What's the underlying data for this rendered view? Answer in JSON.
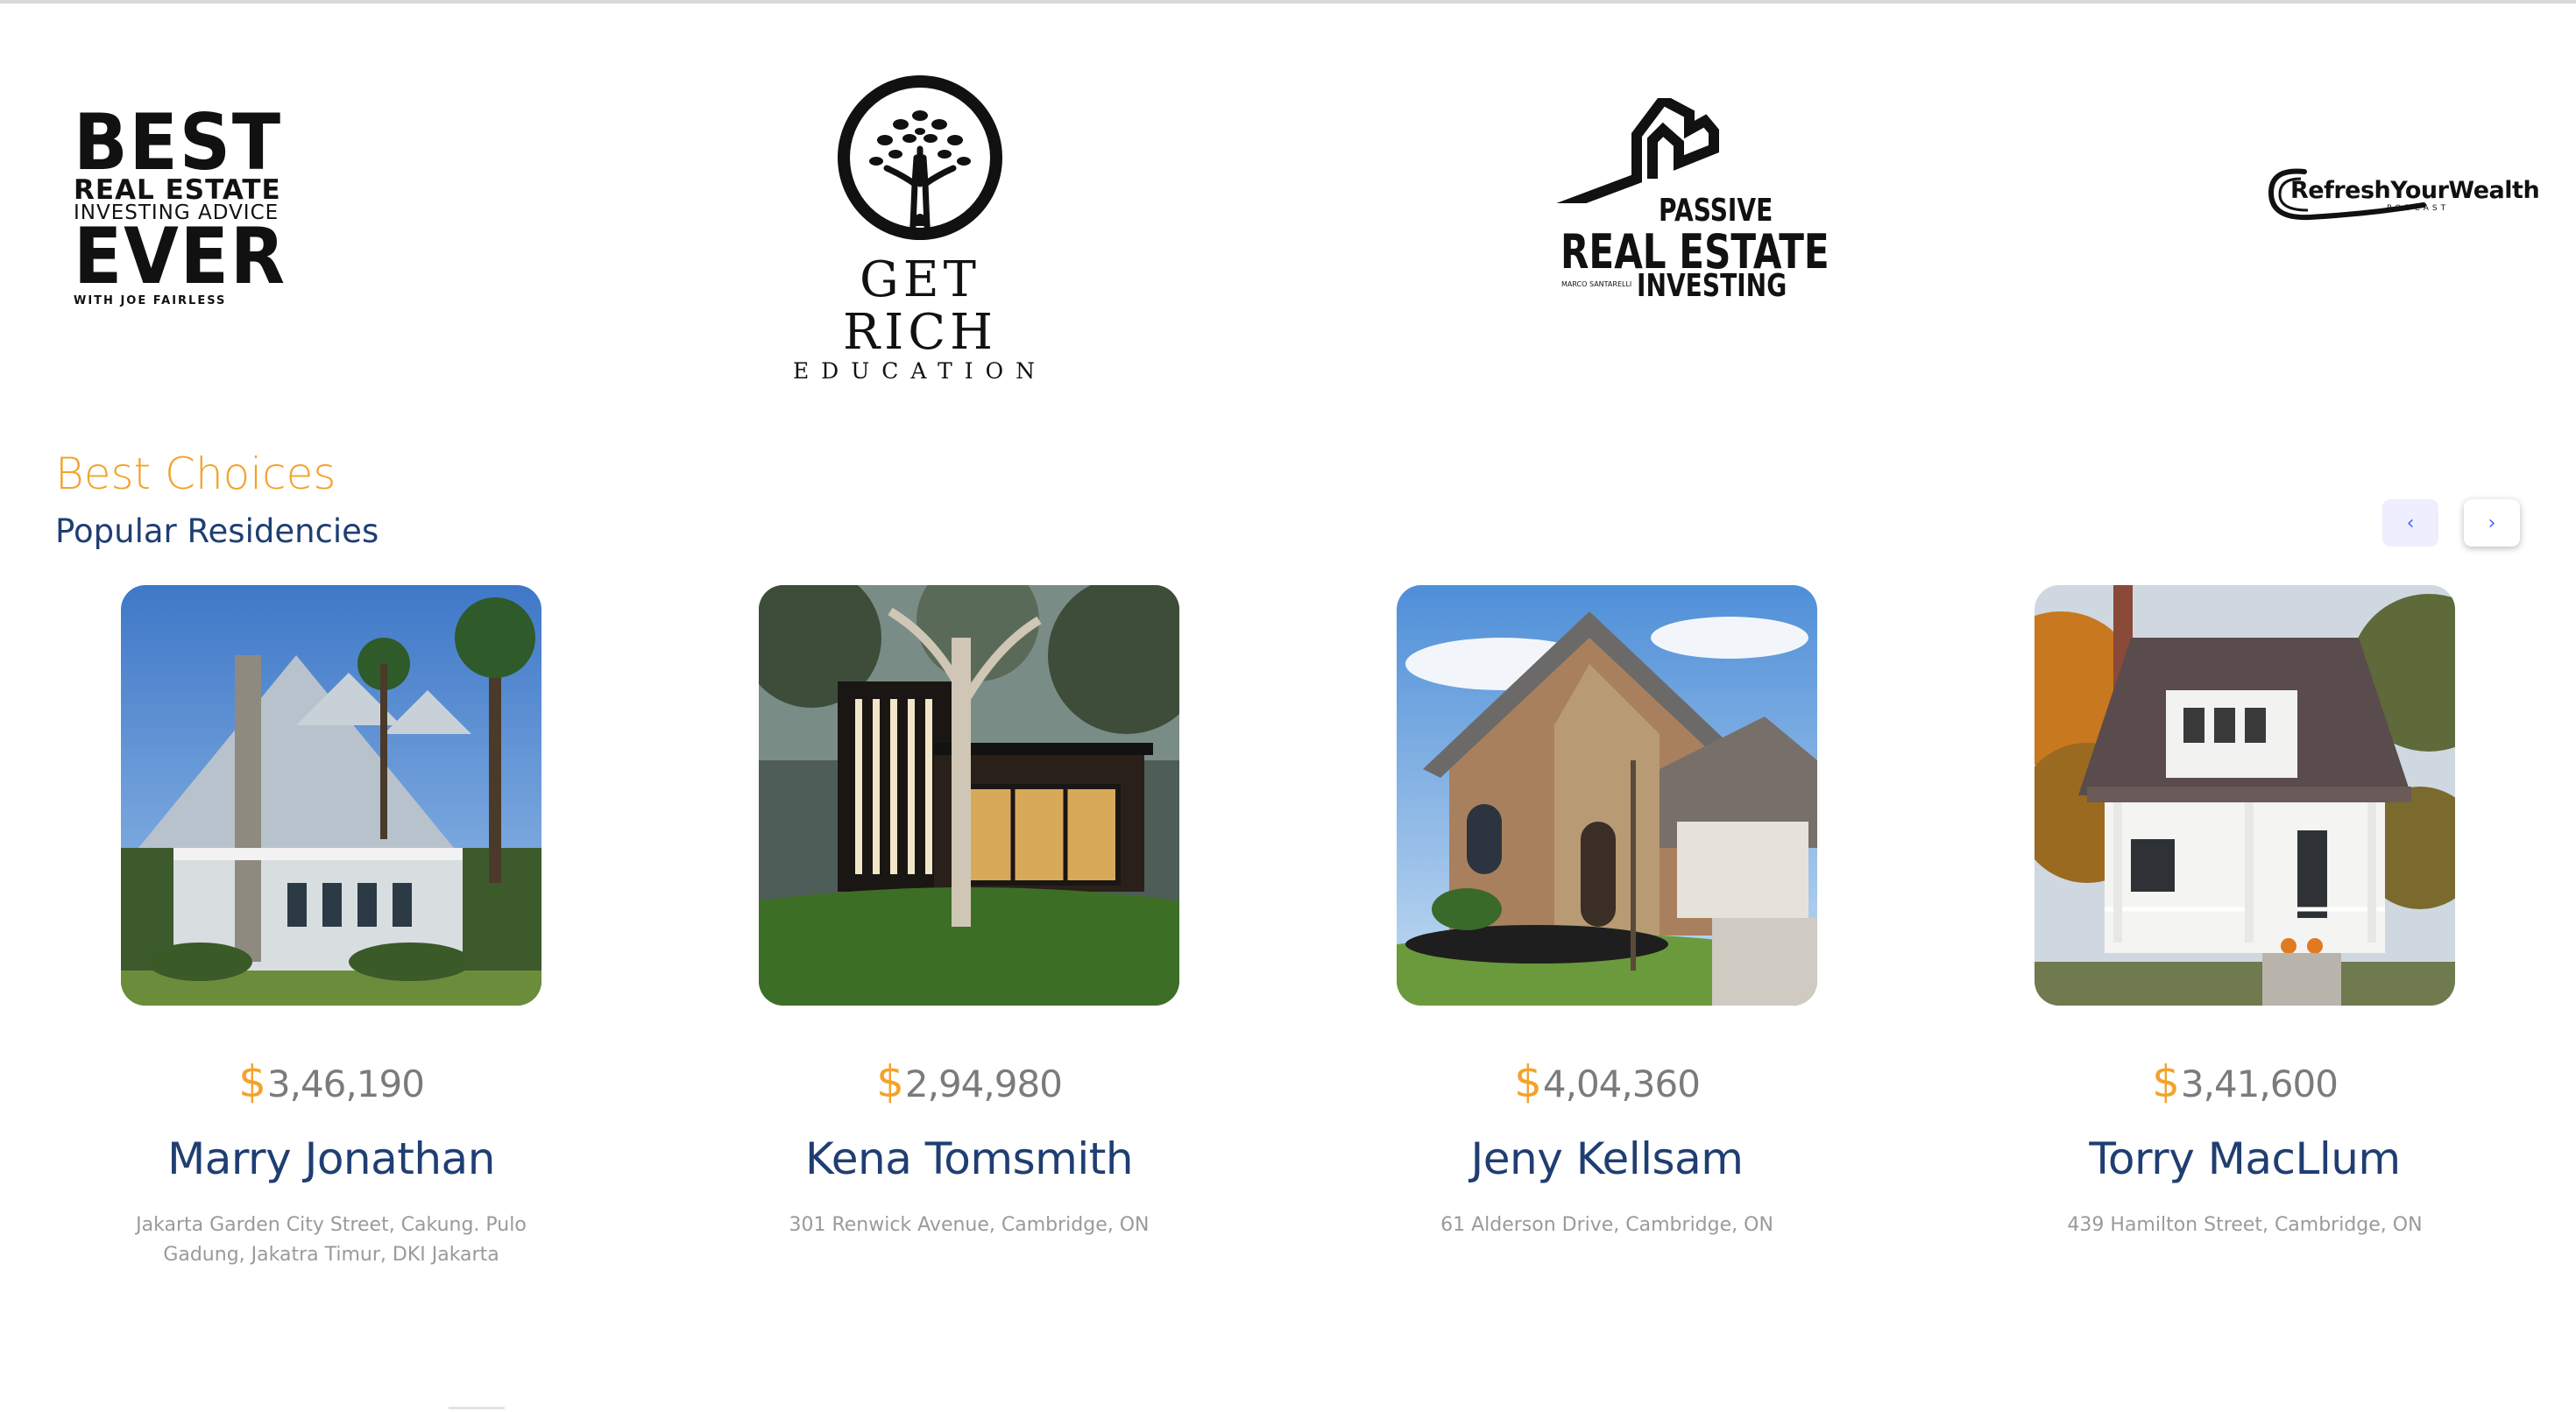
{
  "logos": {
    "best_ever": {
      "line1": "BEST",
      "line2": "REAL ESTATE",
      "line3": "INVESTING ADVICE",
      "line4": "EVER",
      "line5": "WITH JOE FAIRLESS"
    },
    "get_rich": {
      "line1": "GET RICH",
      "line2": "EDUCATION"
    },
    "passive": {
      "line1": "PASSIVE",
      "line2": "REAL ESTATE",
      "line3": "INVESTING",
      "small": "MARCO SANTARELLI"
    },
    "refresh": {
      "line1": "RefreshYourWealth",
      "line2": "PODCAST"
    }
  },
  "section": {
    "eyebrow": "Best Choices",
    "heading": "Popular Residencies",
    "prev_icon": "chevron-left-icon",
    "next_icon": "chevron-right-icon",
    "prev_glyph": "‹",
    "next_glyph": "›"
  },
  "colors": {
    "accent": "#f3a32b",
    "primary": "#1f3e72",
    "muted": "#9a9a9a",
    "nav_bg": "#eeeeff"
  },
  "cards": [
    {
      "currency": "$",
      "price": "3,46,190",
      "name": "Marry Jonathan",
      "address": "Jakarta Garden City Street, Cakung. Pulo Gadung, Jakatra Timur, DKI Jakarta"
    },
    {
      "currency": "$",
      "price": "2,94,980",
      "name": "Kena Tomsmith",
      "address": "301 Renwick Avenue, Cambridge, ON"
    },
    {
      "currency": "$",
      "price": "4,04,360",
      "name": "Jeny Kellsam",
      "address": "61 Alderson Drive, Cambridge, ON"
    },
    {
      "currency": "$",
      "price": "3,41,600",
      "name": "Torry MacLlum",
      "address": "439 Hamilton Street, Cambridge, ON"
    }
  ]
}
